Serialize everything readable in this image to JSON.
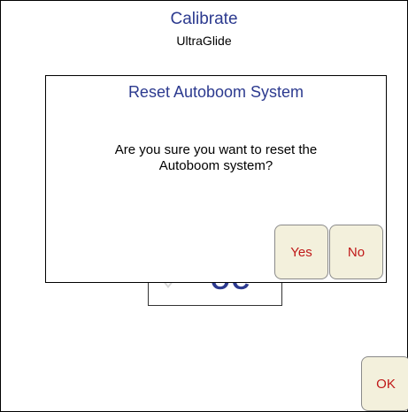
{
  "header": {
    "title": "Calibrate",
    "subtitle": "UltraGlide"
  },
  "background_control": {
    "value_partial": "OC"
  },
  "dialog": {
    "title": "Reset Autoboom System",
    "message_line1": "Are you sure you want to reset the",
    "message_line2": "Autoboom system?",
    "yes_label": "Yes",
    "no_label": "No"
  },
  "footer": {
    "ok_label": "OK"
  },
  "colors": {
    "title_blue": "#2c3a8f",
    "button_text_red": "#c01818",
    "button_bg": "#f3f0dc"
  }
}
